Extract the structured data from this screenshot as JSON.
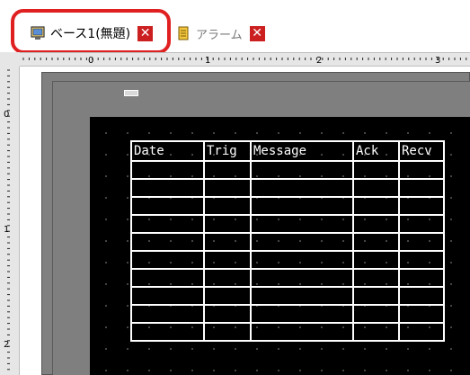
{
  "tabs": [
    {
      "label": "ベース1(無題)",
      "active": true,
      "icon": "screen-icon"
    },
    {
      "label": "アラーム",
      "active": false,
      "icon": "alarm-icon"
    }
  ],
  "ruler_h_labels": [
    "0",
    "1",
    "2",
    "3"
  ],
  "ruler_v_labels": [
    "0",
    "1",
    "2"
  ],
  "table": {
    "headers": [
      "Date",
      "Trig",
      "Message",
      "Ack",
      "Recv"
    ],
    "row_count": 10
  },
  "colors": {
    "highlight": "#e02020",
    "close": "#cc2020",
    "screen": "#000000"
  }
}
